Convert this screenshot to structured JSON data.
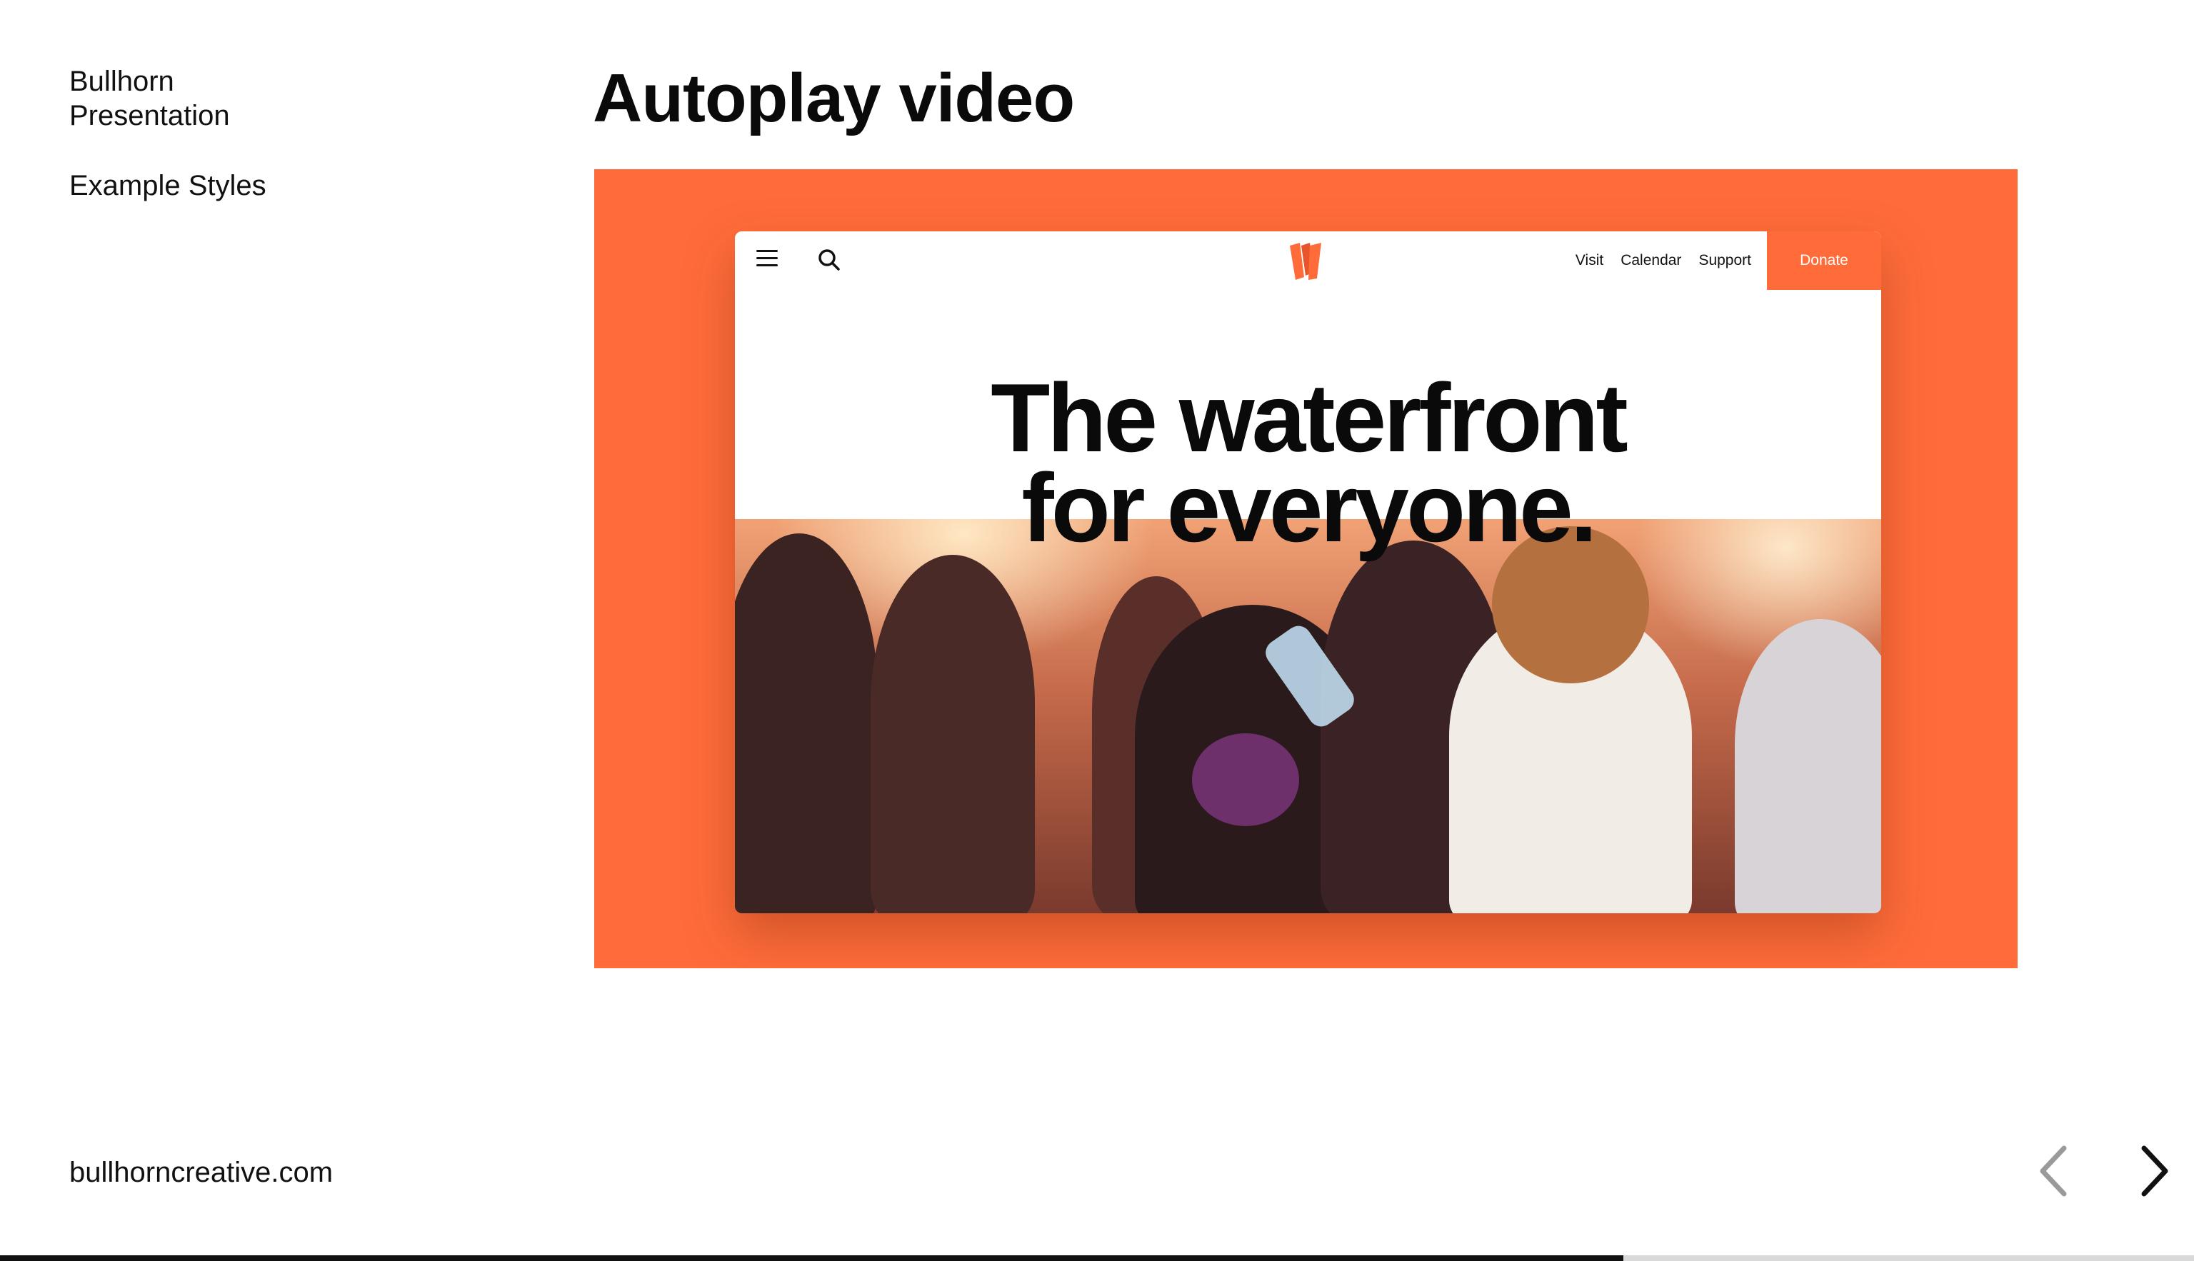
{
  "sidebar": {
    "brand": "Bullhorn\nPresentation",
    "nav_link": "Example Styles"
  },
  "page_title": "Autoplay video",
  "media": {
    "frame_color": "#ff6c3a",
    "site": {
      "nav": {
        "menu_icon": "hamburger-menu-icon",
        "search_icon": "search-icon",
        "logo_icon": "orange-w-logo",
        "links": [
          "Visit",
          "Calendar",
          "Support"
        ],
        "donate": "Donate"
      },
      "hero": {
        "line1": "The waterfront",
        "line2": "for everyone."
      }
    }
  },
  "footer": {
    "link": "bullhorncreative.com",
    "prev_icon": "chevron-left-icon",
    "next_icon": "chevron-right-icon",
    "progress": 0.74
  },
  "colors": {
    "accent": "#ff6c3a",
    "text": "#111111",
    "progress_track": "#d9d9d9"
  }
}
